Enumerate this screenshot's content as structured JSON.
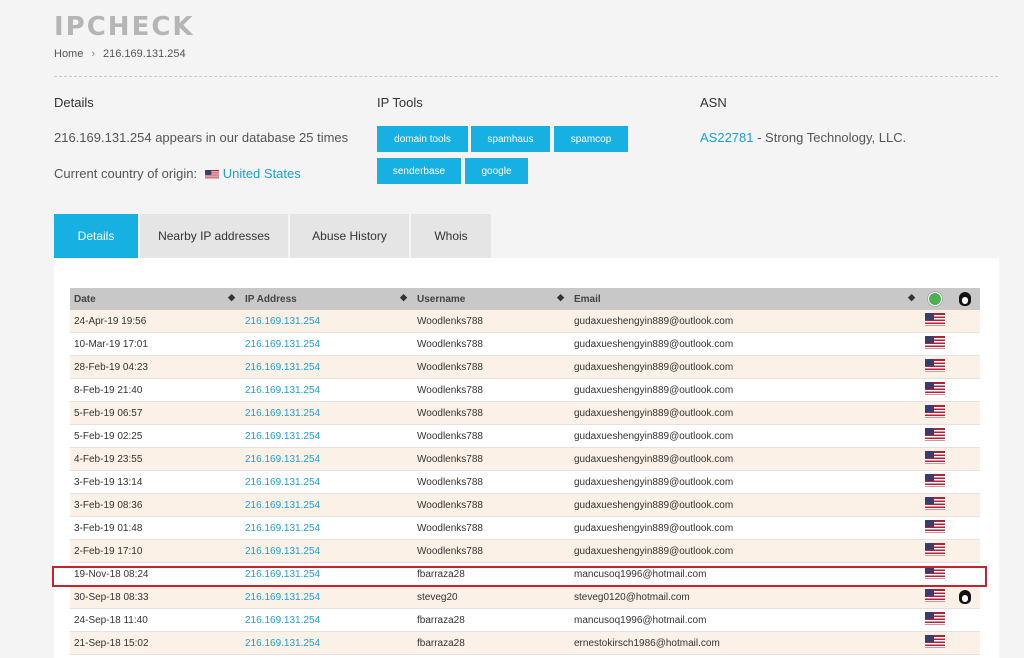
{
  "brand": "IPCHECK",
  "breadcrumb": {
    "home": "Home",
    "separator": "›",
    "current": "216.169.131.254"
  },
  "details": {
    "heading": "Details",
    "database_text": "216.169.131.254 appears in our database 25 times",
    "country_label": "Current country of origin:",
    "country_value": "United States"
  },
  "ip_tools": {
    "heading": "IP Tools",
    "buttons": [
      "domain tools",
      "spamhaus",
      "spamcop",
      "senderbase",
      "google"
    ]
  },
  "asn": {
    "heading": "ASN",
    "number": "AS22781",
    "org": " - Strong Technology, LLC."
  },
  "tabs": [
    "Details",
    "Nearby IP addresses",
    "Abuse History",
    "Whois"
  ],
  "table": {
    "columns": [
      "Date",
      "IP Address",
      "Username",
      "Email"
    ],
    "rows": [
      [
        "24-Apr-19 19:56",
        "216.169.131.254",
        "Woodlenks788",
        "gudaxueshengyin889@outlook.com"
      ],
      [
        "10-Mar-19 17:01",
        "216.169.131.254",
        "Woodlenks788",
        "gudaxueshengyin889@outlook.com"
      ],
      [
        "28-Feb-19 04:23",
        "216.169.131.254",
        "Woodlenks788",
        "gudaxueshengyin889@outlook.com"
      ],
      [
        "8-Feb-19 21:40",
        "216.169.131.254",
        "Woodlenks788",
        "gudaxueshengyin889@outlook.com"
      ],
      [
        "5-Feb-19 06:57",
        "216.169.131.254",
        "Woodlenks788",
        "gudaxueshengyin889@outlook.com"
      ],
      [
        "5-Feb-19 02:25",
        "216.169.131.254",
        "Woodlenks788",
        "gudaxueshengyin889@outlook.com"
      ],
      [
        "4-Feb-19 23:55",
        "216.169.131.254",
        "Woodlenks788",
        "gudaxueshengyin889@outlook.com"
      ],
      [
        "3-Feb-19 13:14",
        "216.169.131.254",
        "Woodlenks788",
        "gudaxueshengyin889@outlook.com"
      ],
      [
        "3-Feb-19 08:36",
        "216.169.131.254",
        "Woodlenks788",
        "gudaxueshengyin889@outlook.com"
      ],
      [
        "3-Feb-19 01:48",
        "216.169.131.254",
        "Woodlenks788",
        "gudaxueshengyin889@outlook.com"
      ],
      [
        "2-Feb-19 17:10",
        "216.169.131.254",
        "Woodlenks788",
        "gudaxueshengyin889@outlook.com"
      ],
      [
        "19-Nov-18 08:24",
        "216.169.131.254",
        "fbarraza28",
        "mancusoq1996@hotmail.com"
      ],
      [
        "30-Sep-18 08:33",
        "216.169.131.254",
        "steveg20",
        "steveg0120@hotmail.com"
      ],
      [
        "24-Sep-18 11:40",
        "216.169.131.254",
        "fbarraza28",
        "mancusoq1996@hotmail.com"
      ],
      [
        "21-Sep-18 15:02",
        "216.169.131.254",
        "fbarraza28",
        "ernestokirsch1986@hotmail.com"
      ]
    ],
    "linux_icon_rows": [
      12
    ]
  },
  "colors": {
    "accent": "#16b0e2",
    "link": "#1ba0d6",
    "highlight": "#c9222c"
  }
}
